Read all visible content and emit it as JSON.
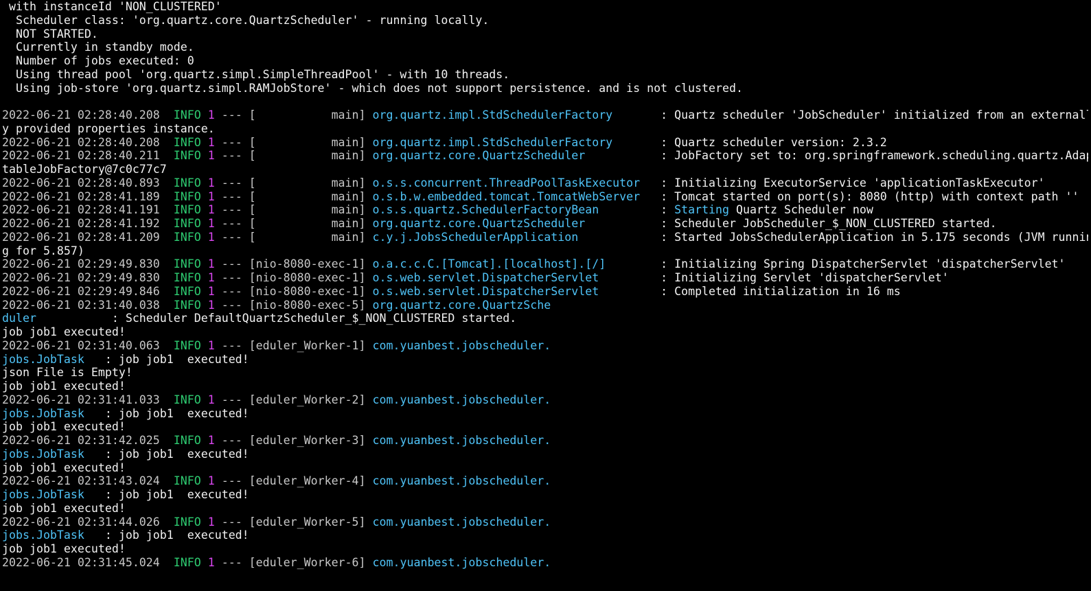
{
  "terminal": {
    "colors": {
      "background": "#000000",
      "text": "#f2f2f2",
      "timestamp": "#c8c8c8",
      "level": "#2ecc71",
      "pid": "#d946ef",
      "logger": "#4fc3f7"
    },
    "lines": [
      {
        "segs": [
          {
            "c": "plain",
            "t": " with instanceId 'NON_CLUSTERED'"
          }
        ]
      },
      {
        "segs": [
          {
            "c": "plain",
            "t": "  Scheduler class: 'org.quartz.core.QuartzScheduler' - running locally."
          }
        ]
      },
      {
        "segs": [
          {
            "c": "plain",
            "t": "  NOT STARTED."
          }
        ]
      },
      {
        "segs": [
          {
            "c": "plain",
            "t": "  Currently in standby mode."
          }
        ]
      },
      {
        "segs": [
          {
            "c": "plain",
            "t": "  Number of jobs executed: 0"
          }
        ]
      },
      {
        "segs": [
          {
            "c": "plain",
            "t": "  Using thread pool 'org.quartz.simpl.SimpleThreadPool' - with 10 threads."
          }
        ]
      },
      {
        "segs": [
          {
            "c": "plain",
            "t": "  Using job-store 'org.quartz.simpl.RAMJobStore' - which does not support persistence. and is not clustered."
          }
        ]
      },
      {
        "segs": [
          {
            "c": "plain",
            "t": ""
          }
        ]
      },
      {
        "segs": [
          {
            "c": "ts",
            "t": "2022-06-21 02:28:40.208  "
          },
          {
            "c": "lvl",
            "t": "INFO"
          },
          {
            "c": "plain",
            "t": " "
          },
          {
            "c": "pid",
            "t": "1"
          },
          {
            "c": "punct",
            "t": " --- [           main] "
          },
          {
            "c": "logger",
            "t": "org.quartz.impl.StdSchedulerFactory      "
          },
          {
            "c": "msg",
            "t": " : Quartz scheduler 'JobScheduler' initialized from an externall"
          }
        ]
      },
      {
        "segs": [
          {
            "c": "plain",
            "t": "y provided properties instance."
          }
        ]
      },
      {
        "segs": [
          {
            "c": "ts",
            "t": "2022-06-21 02:28:40.208  "
          },
          {
            "c": "lvl",
            "t": "INFO"
          },
          {
            "c": "plain",
            "t": " "
          },
          {
            "c": "pid",
            "t": "1"
          },
          {
            "c": "punct",
            "t": " --- [           main] "
          },
          {
            "c": "logger",
            "t": "org.quartz.impl.StdSchedulerFactory      "
          },
          {
            "c": "msg",
            "t": " : Quartz scheduler version: 2.3.2"
          }
        ]
      },
      {
        "segs": [
          {
            "c": "ts",
            "t": "2022-06-21 02:28:40.211  "
          },
          {
            "c": "lvl",
            "t": "INFO"
          },
          {
            "c": "plain",
            "t": " "
          },
          {
            "c": "pid",
            "t": "1"
          },
          {
            "c": "punct",
            "t": " --- [           main] "
          },
          {
            "c": "logger",
            "t": "org.quartz.core.QuartzScheduler          "
          },
          {
            "c": "msg",
            "t": " : JobFactory set to: org.springframework.scheduling.quartz.Adap"
          }
        ]
      },
      {
        "segs": [
          {
            "c": "plain",
            "t": "tableJobFactory@7c0c77c7"
          }
        ]
      },
      {
        "segs": [
          {
            "c": "ts",
            "t": "2022-06-21 02:28:40.893  "
          },
          {
            "c": "lvl",
            "t": "INFO"
          },
          {
            "c": "plain",
            "t": " "
          },
          {
            "c": "pid",
            "t": "1"
          },
          {
            "c": "punct",
            "t": " --- [           main] "
          },
          {
            "c": "logger",
            "t": "o.s.s.concurrent.ThreadPoolTaskExecutor  "
          },
          {
            "c": "msg",
            "t": " : Initializing ExecutorService 'applicationTaskExecutor'"
          }
        ]
      },
      {
        "segs": [
          {
            "c": "ts",
            "t": "2022-06-21 02:28:41.189  "
          },
          {
            "c": "lvl",
            "t": "INFO"
          },
          {
            "c": "plain",
            "t": " "
          },
          {
            "c": "pid",
            "t": "1"
          },
          {
            "c": "punct",
            "t": " --- [           main] "
          },
          {
            "c": "logger",
            "t": "o.s.b.w.embedded.tomcat.TomcatWebServer  "
          },
          {
            "c": "msg",
            "t": " : Tomcat started on port(s): 8080 (http) with context path ''"
          }
        ]
      },
      {
        "segs": [
          {
            "c": "ts",
            "t": "2022-06-21 02:28:41.191  "
          },
          {
            "c": "lvl",
            "t": "INFO"
          },
          {
            "c": "plain",
            "t": " "
          },
          {
            "c": "pid",
            "t": "1"
          },
          {
            "c": "punct",
            "t": " --- [           main] "
          },
          {
            "c": "logger",
            "t": "o.s.s.quartz.SchedulerFactoryBean        "
          },
          {
            "c": "msg",
            "t": " : "
          },
          {
            "c": "hl",
            "t": "Starting"
          },
          {
            "c": "msg",
            "t": " Quartz Scheduler now"
          }
        ]
      },
      {
        "segs": [
          {
            "c": "ts",
            "t": "2022-06-21 02:28:41.192  "
          },
          {
            "c": "lvl",
            "t": "INFO"
          },
          {
            "c": "plain",
            "t": " "
          },
          {
            "c": "pid",
            "t": "1"
          },
          {
            "c": "punct",
            "t": " --- [           main] "
          },
          {
            "c": "logger",
            "t": "org.quartz.core.QuartzScheduler          "
          },
          {
            "c": "msg",
            "t": " : Scheduler JobScheduler_$_NON_CLUSTERED started."
          }
        ]
      },
      {
        "segs": [
          {
            "c": "ts",
            "t": "2022-06-21 02:28:41.209  "
          },
          {
            "c": "lvl",
            "t": "INFO"
          },
          {
            "c": "plain",
            "t": " "
          },
          {
            "c": "pid",
            "t": "1"
          },
          {
            "c": "punct",
            "t": " --- [           main] "
          },
          {
            "c": "logger",
            "t": "c.y.j.JobsSchedulerApplication           "
          },
          {
            "c": "msg",
            "t": " : Started JobsSchedulerApplication in 5.175 seconds (JVM runnin"
          }
        ]
      },
      {
        "segs": [
          {
            "c": "plain",
            "t": "g for 5.857)"
          }
        ]
      },
      {
        "segs": [
          {
            "c": "ts",
            "t": "2022-06-21 02:29:49.830  "
          },
          {
            "c": "lvl",
            "t": "INFO"
          },
          {
            "c": "plain",
            "t": " "
          },
          {
            "c": "pid",
            "t": "1"
          },
          {
            "c": "punct",
            "t": " --- [nio-8080-exec-1] "
          },
          {
            "c": "logger",
            "t": "o.a.c.c.C.[Tomcat].[localhost].[/]       "
          },
          {
            "c": "msg",
            "t": " : Initializing Spring DispatcherServlet 'dispatcherServlet'"
          }
        ]
      },
      {
        "segs": [
          {
            "c": "ts",
            "t": "2022-06-21 02:29:49.830  "
          },
          {
            "c": "lvl",
            "t": "INFO"
          },
          {
            "c": "plain",
            "t": " "
          },
          {
            "c": "pid",
            "t": "1"
          },
          {
            "c": "punct",
            "t": " --- [nio-8080-exec-1] "
          },
          {
            "c": "logger",
            "t": "o.s.web.servlet.DispatcherServlet        "
          },
          {
            "c": "msg",
            "t": " : Initializing Servlet 'dispatcherServlet'"
          }
        ]
      },
      {
        "segs": [
          {
            "c": "ts",
            "t": "2022-06-21 02:29:49.846  "
          },
          {
            "c": "lvl",
            "t": "INFO"
          },
          {
            "c": "plain",
            "t": " "
          },
          {
            "c": "pid",
            "t": "1"
          },
          {
            "c": "punct",
            "t": " --- [nio-8080-exec-1] "
          },
          {
            "c": "logger",
            "t": "o.s.web.servlet.DispatcherServlet        "
          },
          {
            "c": "msg",
            "t": " : Completed initialization in 16 ms"
          }
        ]
      },
      {
        "segs": [
          {
            "c": "ts",
            "t": "2022-06-21 02:31:40.038  "
          },
          {
            "c": "lvl",
            "t": "INFO"
          },
          {
            "c": "plain",
            "t": " "
          },
          {
            "c": "pid",
            "t": "1"
          },
          {
            "c": "punct",
            "t": " --- [nio-8080-exec-5] "
          },
          {
            "c": "logger",
            "t": "org.quartz.core.QuartzSche"
          }
        ]
      },
      {
        "segs": [
          {
            "c": "logger",
            "t": "duler          "
          },
          {
            "c": "msg",
            "t": " : Scheduler DefaultQuartzScheduler_$_NON_CLUSTERED started."
          }
        ]
      },
      {
        "segs": [
          {
            "c": "plain",
            "t": "job job1 executed!"
          }
        ]
      },
      {
        "segs": [
          {
            "c": "ts",
            "t": "2022-06-21 02:31:40.063  "
          },
          {
            "c": "lvl",
            "t": "INFO"
          },
          {
            "c": "plain",
            "t": " "
          },
          {
            "c": "pid",
            "t": "1"
          },
          {
            "c": "punct",
            "t": " --- [eduler_Worker-1] "
          },
          {
            "c": "logger",
            "t": "com.yuanbest.jobscheduler."
          }
        ]
      },
      {
        "segs": [
          {
            "c": "logger",
            "t": "jobs.JobTask  "
          },
          {
            "c": "msg",
            "t": " : job job1  executed!"
          }
        ]
      },
      {
        "segs": [
          {
            "c": "plain",
            "t": "json File is Empty!"
          }
        ]
      },
      {
        "segs": [
          {
            "c": "plain",
            "t": "job job1 executed!"
          }
        ]
      },
      {
        "segs": [
          {
            "c": "ts",
            "t": "2022-06-21 02:31:41.033  "
          },
          {
            "c": "lvl",
            "t": "INFO"
          },
          {
            "c": "plain",
            "t": " "
          },
          {
            "c": "pid",
            "t": "1"
          },
          {
            "c": "punct",
            "t": " --- [eduler_Worker-2] "
          },
          {
            "c": "logger",
            "t": "com.yuanbest.jobscheduler."
          }
        ]
      },
      {
        "segs": [
          {
            "c": "logger",
            "t": "jobs.JobTask  "
          },
          {
            "c": "msg",
            "t": " : job job1  executed!"
          }
        ]
      },
      {
        "segs": [
          {
            "c": "plain",
            "t": "job job1 executed!"
          }
        ]
      },
      {
        "segs": [
          {
            "c": "ts",
            "t": "2022-06-21 02:31:42.025  "
          },
          {
            "c": "lvl",
            "t": "INFO"
          },
          {
            "c": "plain",
            "t": " "
          },
          {
            "c": "pid",
            "t": "1"
          },
          {
            "c": "punct",
            "t": " --- [eduler_Worker-3] "
          },
          {
            "c": "logger",
            "t": "com.yuanbest.jobscheduler."
          }
        ]
      },
      {
        "segs": [
          {
            "c": "logger",
            "t": "jobs.JobTask  "
          },
          {
            "c": "msg",
            "t": " : job job1  executed!"
          }
        ]
      },
      {
        "segs": [
          {
            "c": "plain",
            "t": "job job1 executed!"
          }
        ]
      },
      {
        "segs": [
          {
            "c": "ts",
            "t": "2022-06-21 02:31:43.024  "
          },
          {
            "c": "lvl",
            "t": "INFO"
          },
          {
            "c": "plain",
            "t": " "
          },
          {
            "c": "pid",
            "t": "1"
          },
          {
            "c": "punct",
            "t": " --- [eduler_Worker-4] "
          },
          {
            "c": "logger",
            "t": "com.yuanbest.jobscheduler."
          }
        ]
      },
      {
        "segs": [
          {
            "c": "logger",
            "t": "jobs.JobTask  "
          },
          {
            "c": "msg",
            "t": " : job job1  executed!"
          }
        ]
      },
      {
        "segs": [
          {
            "c": "plain",
            "t": "job job1 executed!"
          }
        ]
      },
      {
        "segs": [
          {
            "c": "ts",
            "t": "2022-06-21 02:31:44.026  "
          },
          {
            "c": "lvl",
            "t": "INFO"
          },
          {
            "c": "plain",
            "t": " "
          },
          {
            "c": "pid",
            "t": "1"
          },
          {
            "c": "punct",
            "t": " --- [eduler_Worker-5] "
          },
          {
            "c": "logger",
            "t": "com.yuanbest.jobscheduler."
          }
        ]
      },
      {
        "segs": [
          {
            "c": "logger",
            "t": "jobs.JobTask  "
          },
          {
            "c": "msg",
            "t": " : job job1  executed!"
          }
        ]
      },
      {
        "segs": [
          {
            "c": "plain",
            "t": "job job1 executed!"
          }
        ]
      },
      {
        "segs": [
          {
            "c": "ts",
            "t": "2022-06-21 02:31:45.024  "
          },
          {
            "c": "lvl",
            "t": "INFO"
          },
          {
            "c": "plain",
            "t": " "
          },
          {
            "c": "pid",
            "t": "1"
          },
          {
            "c": "punct",
            "t": " --- [eduler_Worker-6] "
          },
          {
            "c": "logger",
            "t": "com.yuanbest.jobscheduler."
          }
        ]
      }
    ]
  }
}
